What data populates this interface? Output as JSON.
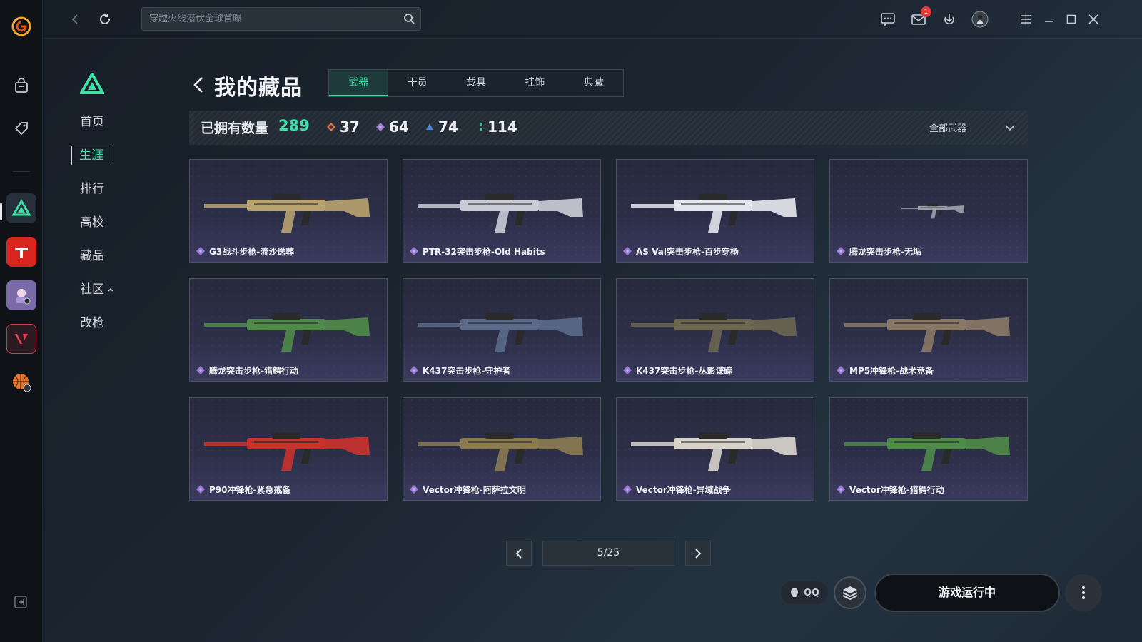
{
  "topbar": {
    "search_placeholder": "穿越火线潜伏全球首曝",
    "mail_badge": "1"
  },
  "rail": {
    "items": [
      "app-logo",
      "shop",
      "tag",
      "delta-force",
      "crossfire",
      "anime-game",
      "valorant-like",
      "basketball-game"
    ]
  },
  "secondary_nav": {
    "items": [
      {
        "label": "首页"
      },
      {
        "label": "生涯"
      },
      {
        "label": "排行"
      },
      {
        "label": "高校"
      },
      {
        "label": "藏品"
      },
      {
        "label": "社区"
      },
      {
        "label": "改枪"
      }
    ],
    "active_index": 1
  },
  "page": {
    "title": "我的藏品",
    "tabs": [
      "武器",
      "干员",
      "载具",
      "挂饰",
      "典藏"
    ],
    "active_tab": 0
  },
  "stats": {
    "own_label": "已拥有数量",
    "own_count": "289",
    "tiers": [
      {
        "value": "37",
        "color": "#e8743b"
      },
      {
        "value": "64",
        "color": "#9b7ad8"
      },
      {
        "value": "74",
        "color": "#4a86d6"
      },
      {
        "value": "114",
        "color": "#3fcf9a"
      }
    ],
    "filter_label": "全部武器"
  },
  "items": [
    {
      "name": "G3战斗步枪-流沙送葬",
      "color": "#b8a270"
    },
    {
      "name": "PTR-32突击步枪-Old Habits",
      "color": "#c9ccd6"
    },
    {
      "name": "AS Val突击步枪-百步穿杨",
      "color": "#e6e6ee"
    },
    {
      "name": "腾龙突击步枪-无垢",
      "color": "#9aa0aa"
    },
    {
      "name": "腾龙突击步枪-猎鳄行动",
      "color": "#4f8a4a"
    },
    {
      "name": "K437突击步枪-守护者",
      "color": "#5a6a88"
    },
    {
      "name": "K437突击步枪-丛影谍踪",
      "color": "#6a6650"
    },
    {
      "name": "MP5冲锋枪-战术竞备",
      "color": "#8a7866"
    },
    {
      "name": "P90冲锋枪-紧急戒备",
      "color": "#c8322e"
    },
    {
      "name": "Vector冲锋枪-阿萨拉文明",
      "color": "#8a7a52"
    },
    {
      "name": "Vector冲锋枪-异域战争",
      "color": "#d8d4cc"
    },
    {
      "name": "Vector冲锋枪-猎鳄行动",
      "color": "#4f8a4a"
    }
  ],
  "pagination": {
    "label": "5/25"
  },
  "bottom": {
    "qq_label": "QQ",
    "run_label": "游戏运行中"
  }
}
